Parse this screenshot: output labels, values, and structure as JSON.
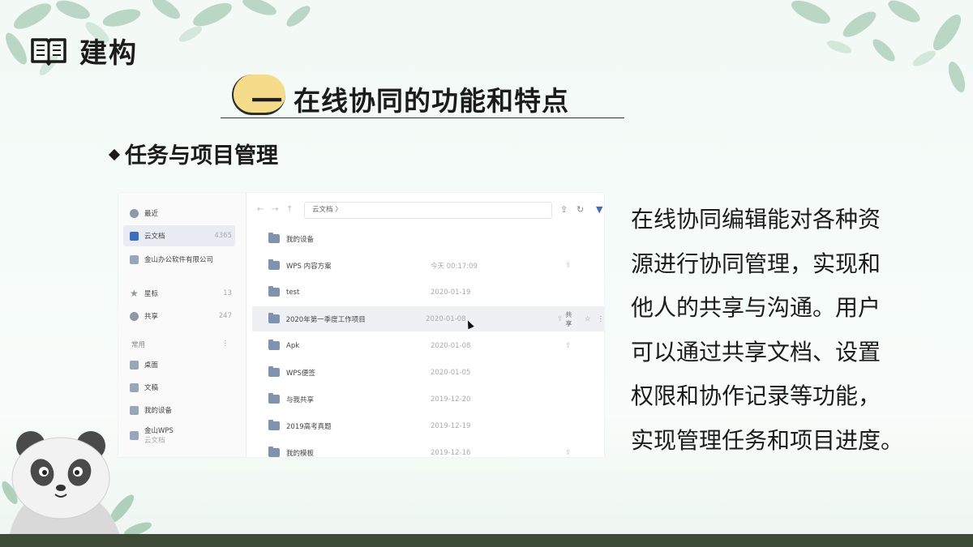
{
  "header": {
    "title": "建构",
    "icon": "book-icon"
  },
  "section": {
    "number": "一",
    "title": "在线协同的功能和特点"
  },
  "subheading": "任务与项目管理",
  "screenshot": {
    "sidebar": {
      "items": [
        {
          "label": "最近",
          "count": "",
          "icon": "clock-icon"
        },
        {
          "label": "云文档",
          "count": "4365",
          "icon": "cloud-doc-icon"
        },
        {
          "label": "金山办公软件有限公司",
          "count": "",
          "icon": "company-icon"
        },
        {
          "label": "星标",
          "count": "13",
          "icon": "star-icon"
        },
        {
          "label": "共享",
          "count": "247",
          "icon": "share-users-icon"
        }
      ],
      "group_label": "常用",
      "group_items": [
        {
          "label": "桌面",
          "icon": "desktop-icon"
        },
        {
          "label": "文稿",
          "icon": "doc-folder-icon"
        },
        {
          "label": "我的设备",
          "icon": "device-icon"
        },
        {
          "label": "金山WPS",
          "sublabel": "云文档",
          "icon": "wps-icon"
        }
      ]
    },
    "path": "云文档  〉",
    "rows": [
      {
        "name": "我的设备",
        "date": "",
        "share": false
      },
      {
        "name": "WPS 内容方案",
        "date": "今天 00:17:09",
        "share": true
      },
      {
        "name": "test",
        "date": "2020-01-19",
        "share": false
      },
      {
        "name": "2020年第一季度工作项目",
        "date": "2020-01-08",
        "share": true,
        "share_label": "共享"
      },
      {
        "name": "Apk",
        "date": "2020-01-08",
        "share": true
      },
      {
        "name": "WPS便签",
        "date": "2020-01-05",
        "share": false
      },
      {
        "name": "与我共享",
        "date": "2019-12-20",
        "share": false
      },
      {
        "name": "2019高考真题",
        "date": "2019-12-19",
        "share": false
      },
      {
        "name": "我的模板",
        "date": "2019-12-16",
        "share": true
      }
    ]
  },
  "paragraph": [
    "在线协同编辑能对各种资",
    "源进行协同管理，实现和",
    "他人的共享与沟通。用户",
    "可以通过共享文档、设置",
    "权限和协作记录等功能，",
    "实现管理任务和项目进度。"
  ],
  "colors": {
    "badge": "#f4dc8a",
    "footer": "#3e4b36",
    "active": "#3d6fb8"
  }
}
